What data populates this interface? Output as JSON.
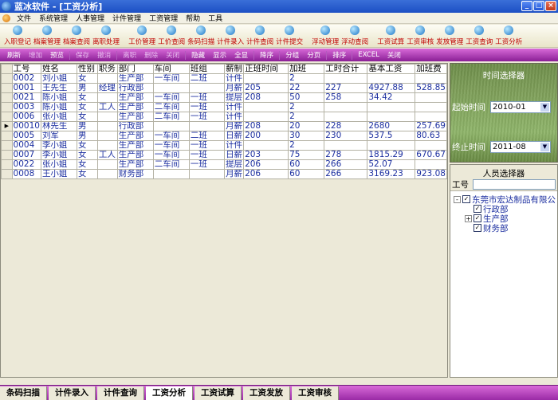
{
  "window": {
    "title": "蓝冰软件 - [工资分析]"
  },
  "menu": [
    "文件",
    "系统管理",
    "人事管理",
    "计件管理",
    "工资管理",
    "帮助",
    "工具"
  ],
  "toolbar": [
    {
      "label": "入职登记"
    },
    {
      "label": "档案管理"
    },
    {
      "label": "档案查阅"
    },
    {
      "label": "离职处理"
    },
    {
      "gap": true
    },
    {
      "label": "工价管理"
    },
    {
      "label": "工价查阅"
    },
    {
      "label": "条码扫描"
    },
    {
      "label": "计件录入"
    },
    {
      "label": "计件查阅"
    },
    {
      "label": "计件提交"
    },
    {
      "gap": true
    },
    {
      "label": "浮动管理"
    },
    {
      "label": "浮动查阅"
    },
    {
      "gap": true
    },
    {
      "label": "工资试算"
    },
    {
      "label": "工资审核"
    },
    {
      "label": "发放管理"
    },
    {
      "label": "工资查询"
    },
    {
      "label": "工资分析"
    }
  ],
  "toolbar2": [
    {
      "label": "刷新"
    },
    {
      "label": "增加",
      "disabled": true
    },
    {
      "label": "预览"
    },
    {
      "sep": true
    },
    {
      "label": "保存",
      "disabled": true
    },
    {
      "label": "撤消",
      "disabled": true
    },
    {
      "sep": true
    },
    {
      "label": "离职",
      "disabled": true
    },
    {
      "label": "删除",
      "disabled": true
    },
    {
      "label": "关闭",
      "disabled": true
    },
    {
      "sep": true
    },
    {
      "label": "隐藏"
    },
    {
      "label": "显示"
    },
    {
      "label": "全显"
    },
    {
      "sep": true
    },
    {
      "label": "降序"
    },
    {
      "sep": true
    },
    {
      "label": "分组"
    },
    {
      "label": "分页"
    },
    {
      "sep": true
    },
    {
      "label": "排序"
    },
    {
      "sep": true
    },
    {
      "label": "EXCEL"
    },
    {
      "label": "关闭"
    }
  ],
  "grid": {
    "columns": [
      "工号",
      "姓名",
      "性别",
      "职务",
      "部门",
      "车间",
      "班组",
      "薪制",
      "正班时间",
      "加班",
      "工时合计",
      "基本工资",
      "加班费"
    ],
    "rows": [
      [
        "0002",
        "刘小姐",
        "女",
        "",
        "生产部",
        "一车间",
        "二班",
        "计件",
        "",
        "2",
        "",
        "",
        ""
      ],
      [
        "0001",
        "王先生",
        "男",
        "经理",
        "行政部",
        "",
        "",
        "月薪",
        "205",
        "22",
        "227",
        "4927.88",
        "528.85"
      ],
      [
        "0021",
        "陈小姐",
        "女",
        "",
        "生产部",
        "一车间",
        "一班",
        "提层",
        "208",
        "50",
        "258",
        "34.42",
        ""
      ],
      [
        "0003",
        "陈小姐",
        "女",
        "工人",
        "生产部",
        "二车间",
        "一班",
        "计件",
        "",
        "2",
        "",
        "",
        ""
      ],
      [
        "0006",
        "张小姐",
        "女",
        "",
        "生产部",
        "二车间",
        "一班",
        "计件",
        "",
        "2",
        "",
        "",
        ""
      ],
      [
        "00010",
        "林先生",
        "男",
        "",
        "行政部",
        "",
        "",
        "月薪",
        "208",
        "20",
        "228",
        "2680",
        "257.69"
      ],
      [
        "0005",
        "刘军",
        "男",
        "",
        "生产部",
        "一车间",
        "二班",
        "日薪",
        "200",
        "30",
        "230",
        "537.5",
        "80.63"
      ],
      [
        "0004",
        "李小姐",
        "女",
        "",
        "生产部",
        "一车间",
        "一班",
        "计件",
        "",
        "2",
        "",
        "",
        ""
      ],
      [
        "0007",
        "李小姐",
        "女",
        "工人",
        "生产部",
        "一车间",
        "一班",
        "日薪",
        "203",
        "75",
        "278",
        "1815.29",
        "670.67"
      ],
      [
        "0022",
        "张小姐",
        "女",
        "",
        "生产部",
        "二车间",
        "一班",
        "提层",
        "206",
        "60",
        "266",
        "52.07",
        ""
      ],
      [
        "0008",
        "王小姐",
        "女",
        "",
        "财务部",
        "",
        "",
        "月薪",
        "206",
        "60",
        "266",
        "3169.23",
        "923.08"
      ]
    ],
    "current_row": 5
  },
  "time_selector": {
    "title": "时间选择器",
    "start_label": "起始时间",
    "start_value": "2010-01",
    "end_label": "终止时间",
    "end_value": "2011-08"
  },
  "person_selector": {
    "title": "人员选择器",
    "id_label": "工号",
    "tree": [
      {
        "label": "东莞市宏达制品有限公",
        "level": 0,
        "expander": "-",
        "checked": true
      },
      {
        "label": "行政部",
        "level": 1,
        "expander": "",
        "checked": true
      },
      {
        "label": "生产部",
        "level": 1,
        "expander": "+",
        "checked": true
      },
      {
        "label": "财务部",
        "level": 1,
        "expander": "",
        "checked": true
      }
    ]
  },
  "bottom_tabs": [
    "条码扫描",
    "计件录入",
    "计件查询",
    "工资分析",
    "工资试算",
    "工资发放",
    "工资审核"
  ],
  "active_tab": 3
}
